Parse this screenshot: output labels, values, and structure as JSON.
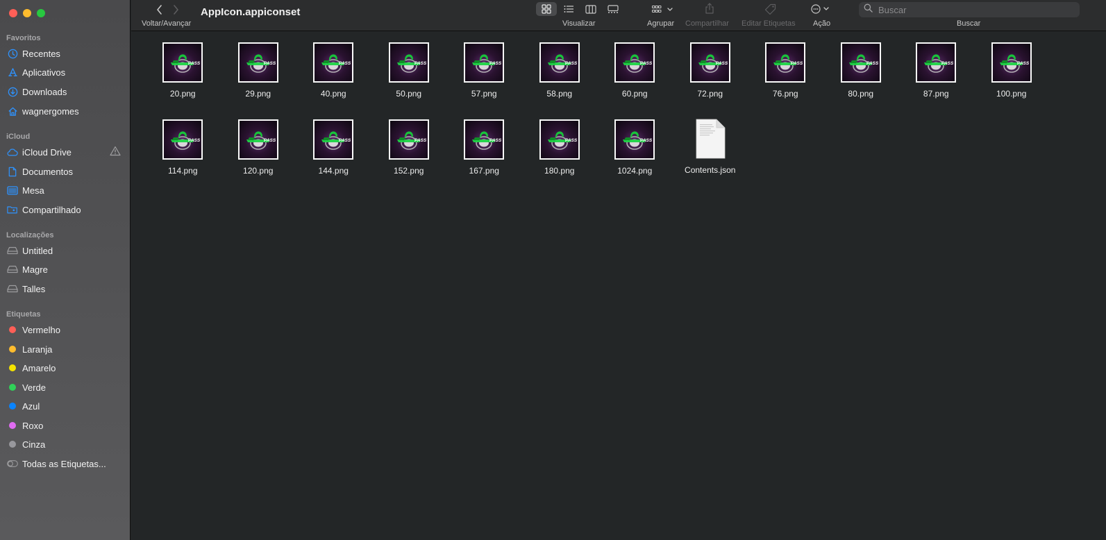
{
  "window": {
    "traffic_lights": {
      "close": "#ff5f57",
      "minimize": "#febc2e",
      "zoom": "#28c840"
    }
  },
  "sidebar": {
    "favorites_title": "Favoritos",
    "favorites": [
      {
        "label": "Recentes",
        "icon": "clock-icon"
      },
      {
        "label": "Aplicativos",
        "icon": "applications-icon"
      },
      {
        "label": "Downloads",
        "icon": "download-icon"
      },
      {
        "label": "wagnergomes",
        "icon": "home-icon"
      }
    ],
    "icloud_title": "iCloud",
    "icloud": [
      {
        "label": "iCloud Drive",
        "icon": "cloud-icon"
      },
      {
        "label": "Documentos",
        "icon": "document-icon"
      },
      {
        "label": "Mesa",
        "icon": "desktop-icon"
      },
      {
        "label": "Compartilhado",
        "icon": "shared-folder-icon"
      }
    ],
    "locations_title": "Localizações",
    "locations": [
      {
        "label": "Untitled",
        "icon": "drive-icon"
      },
      {
        "label": "Magre",
        "icon": "drive-icon"
      },
      {
        "label": "Talles",
        "icon": "drive-icon"
      }
    ],
    "tags_title": "Etiquetas",
    "tags": [
      {
        "label": "Vermelho",
        "color": "#ff5f57"
      },
      {
        "label": "Laranja",
        "color": "#febc2e"
      },
      {
        "label": "Amarelo",
        "color": "#f5e400"
      },
      {
        "label": "Verde",
        "color": "#30d158"
      },
      {
        "label": "Azul",
        "color": "#0a84ff"
      },
      {
        "label": "Roxo",
        "color": "#e06cf2"
      },
      {
        "label": "Cinza",
        "color": "#98989d"
      }
    ],
    "all_tags": "Todas as Etiquetas..."
  },
  "toolbar": {
    "title": "AppIcon.appiconset",
    "back_forward_label": "Voltar/Avançar",
    "view_label": "Visualizar",
    "group_label": "Agrupar",
    "share_label": "Compartilhar",
    "edit_tags_label": "Editar Etiquetas",
    "action_label": "Ação",
    "search_label": "Buscar",
    "search_placeholder": "Buscar",
    "accent": "#0a84ff"
  },
  "files": [
    {
      "name": "20.png",
      "type": "image"
    },
    {
      "name": "29.png",
      "type": "image"
    },
    {
      "name": "40.png",
      "type": "image"
    },
    {
      "name": "50.png",
      "type": "image"
    },
    {
      "name": "57.png",
      "type": "image"
    },
    {
      "name": "58.png",
      "type": "image"
    },
    {
      "name": "60.png",
      "type": "image"
    },
    {
      "name": "72.png",
      "type": "image"
    },
    {
      "name": "76.png",
      "type": "image"
    },
    {
      "name": "80.png",
      "type": "image"
    },
    {
      "name": "87.png",
      "type": "image"
    },
    {
      "name": "100.png",
      "type": "image"
    },
    {
      "name": "114.png",
      "type": "image"
    },
    {
      "name": "120.png",
      "type": "image"
    },
    {
      "name": "144.png",
      "type": "image"
    },
    {
      "name": "152.png",
      "type": "image"
    },
    {
      "name": "167.png",
      "type": "image"
    },
    {
      "name": "180.png",
      "type": "image"
    },
    {
      "name": "1024.png",
      "type": "image"
    },
    {
      "name": "Contents.json",
      "type": "document"
    }
  ]
}
